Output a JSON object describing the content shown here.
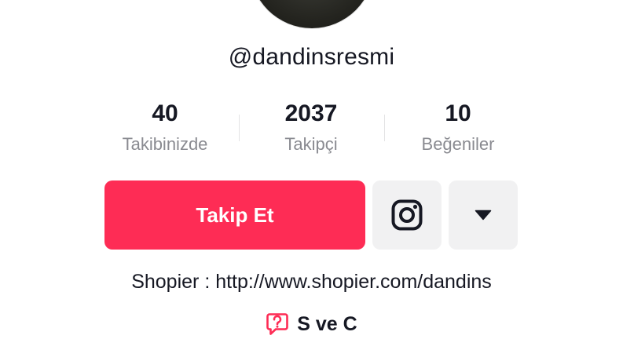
{
  "profile": {
    "username": "@dandinsresmi",
    "bio": "Shopier : http://www.shopier.com/dandins",
    "qa_label": "S ve C"
  },
  "stats": [
    {
      "value": "40",
      "label": "Takibinizde"
    },
    {
      "value": "2037",
      "label": "Takipçi"
    },
    {
      "value": "10",
      "label": "Beğeniler"
    }
  ],
  "actions": {
    "follow_label": "Takip Et",
    "instagram_icon": "instagram-icon",
    "more_icon": "caret-down-icon"
  },
  "colors": {
    "accent": "#fe2c55",
    "secondary_button": "#f1f1f2",
    "muted_text": "#8a8b91"
  }
}
